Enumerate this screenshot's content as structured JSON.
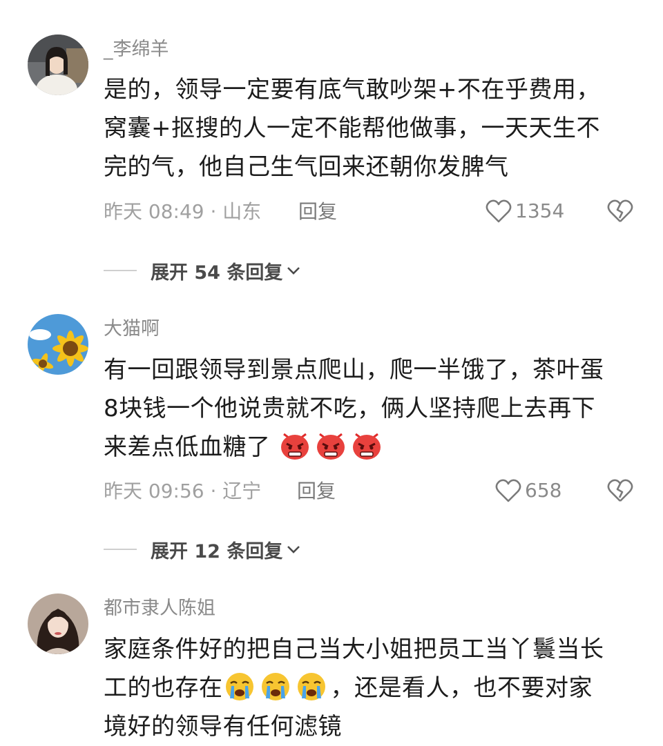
{
  "comments": [
    {
      "username": "_李绵羊",
      "lines": [
        "是的，领导一定要有底气敢吵架+不在乎费用，",
        "窝囊+抠搜的人一定不能帮他做事，一天天生不",
        "完的气，他自己生气回来还朝你发脾气"
      ],
      "meta": "昨天 08:49 · 山东",
      "reply_label": "回复",
      "likes": "1354",
      "expand_label": "展开 54 条回复"
    },
    {
      "username": "大猫啊",
      "lines": [
        "有一回跟领导到景点爬山，爬一半饿了，茶叶蛋",
        "8块钱一个他说贵就不吃，俩人坚持爬上去再下",
        "来差点低血糖了"
      ],
      "emojis_line3": [
        "angry-face-emoji",
        "angry-face-emoji",
        "angry-face-emoji"
      ],
      "meta": "昨天 09:56 · 辽宁",
      "reply_label": "回复",
      "likes": "658",
      "expand_label": "展开 12 条回复"
    },
    {
      "username": "都市隶人陈姐",
      "lines": [
        "家庭条件好的把自己当大小姐把员工当丫鬟当长",
        "工的也存在",
        "境好的领导有任何滤镜"
      ],
      "line2_suffix": "，还是看人，也不要对家",
      "emojis_line2": [
        "crying-face-emoji",
        "crying-face-emoji",
        "crying-face-emoji"
      ]
    }
  ],
  "colors": {
    "text": "#1c1c1c",
    "meta": "#a0a0a0",
    "username": "#8a8a8a"
  }
}
